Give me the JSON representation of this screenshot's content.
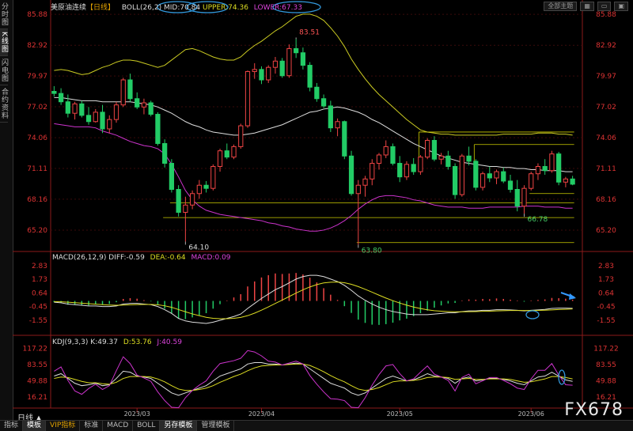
{
  "sidebar": {
    "items": [
      "分时图",
      "K线图",
      "闪电图",
      "合约资料"
    ]
  },
  "toolbar": {
    "theme_btn": "全部主题",
    "icons": [
      "grid-icon",
      "window-icon",
      "panel-icon"
    ]
  },
  "main_header": {
    "symbol": "美原油连续",
    "period": "【日线】",
    "boll_label": "BOLL(26,2)",
    "mid": "MID:70.84",
    "upper": "UPPER:74.36",
    "lower": "LOWER:67.33"
  },
  "macd_header": {
    "label": "MACD(26,12,9)",
    "diff": "DIFF:-0.59",
    "dea": "DEA:-0.64",
    "macd": "MACD:0.09"
  },
  "kdj_header": {
    "label": "KDJ(9,3,3)",
    "k": "K:49.37",
    "d": "D:53.76",
    "j": "J:40.59"
  },
  "price_ticks": [
    "85.88",
    "82.92",
    "79.97",
    "77.02",
    "74.06",
    "71.11",
    "68.16",
    "65.20"
  ],
  "macd_ticks": [
    "2.83",
    "1.73",
    "0.64",
    "-0.45",
    "-1.55"
  ],
  "kdj_ticks": [
    "117.22",
    "83.55",
    "49.88",
    "16.21"
  ],
  "date_labels": [
    "2023/03",
    "2023/04",
    "2023/05",
    "2023/06"
  ],
  "price_annotations": [
    "83.51",
    "64.10",
    "63.80",
    "66.78"
  ],
  "period_label": "日线 ▲",
  "bottom_tabs": [
    "指标",
    "模板",
    "VIP指标",
    "标准",
    "MACD",
    "BOLL",
    "另存模板",
    "管理模板"
  ],
  "watermark": "FX678",
  "colors": {
    "up": "#ee4444",
    "down": "#22cc66",
    "upper": "#cccc22",
    "mid": "#dddddd",
    "lower": "#cc33cc",
    "hline": "#cccc00",
    "circle": "#3399dd"
  },
  "chart_data": {
    "type": "candlestick",
    "title": "美原油连续 日线",
    "ylim": [
      63.3,
      86.5
    ],
    "candles_ohlc": [
      [
        78.5,
        79.0,
        78.0,
        78.3
      ],
      [
        78.3,
        78.8,
        77.2,
        77.5
      ],
      [
        77.5,
        78.2,
        76.0,
        76.4
      ],
      [
        76.4,
        77.5,
        75.8,
        77.3
      ],
      [
        77.3,
        77.6,
        76.0,
        76.2
      ],
      [
        76.2,
        77.0,
        75.3,
        75.6
      ],
      [
        75.6,
        76.8,
        75.5,
        76.5
      ],
      [
        76.5,
        77.2,
        74.5,
        74.9
      ],
      [
        74.9,
        76.2,
        74.5,
        75.8
      ],
      [
        75.8,
        77.5,
        75.5,
        77.2
      ],
      [
        77.2,
        79.8,
        77.0,
        79.6
      ],
      [
        79.6,
        80.2,
        77.5,
        77.8
      ],
      [
        77.8,
        78.4,
        76.8,
        77.0
      ],
      [
        77.0,
        77.8,
        76.3,
        77.4
      ],
      [
        77.4,
        77.6,
        76.1,
        76.3
      ],
      [
        76.3,
        76.5,
        73.3,
        73.5
      ],
      [
        73.5,
        73.9,
        71.2,
        71.6
      ],
      [
        71.6,
        72.0,
        68.8,
        69.1
      ],
      [
        69.1,
        69.5,
        66.5,
        66.9
      ],
      [
        66.9,
        68.4,
        64.1,
        67.6
      ],
      [
        67.6,
        69.0,
        67.2,
        68.7
      ],
      [
        68.7,
        70.0,
        68.2,
        69.5
      ],
      [
        69.5,
        69.9,
        68.8,
        69.2
      ],
      [
        69.2,
        71.5,
        69.0,
        71.3
      ],
      [
        71.3,
        73.0,
        70.8,
        72.8
      ],
      [
        72.8,
        73.5,
        72.0,
        72.2
      ],
      [
        72.2,
        73.4,
        72.0,
        73.2
      ],
      [
        73.2,
        75.4,
        73.0,
        75.2
      ],
      [
        75.2,
        80.5,
        75.0,
        80.4
      ],
      [
        80.4,
        81.2,
        79.7,
        80.6
      ],
      [
        80.6,
        80.9,
        79.2,
        79.6
      ],
      [
        79.6,
        81.0,
        79.3,
        80.8
      ],
      [
        80.8,
        81.8,
        80.2,
        81.4
      ],
      [
        81.4,
        81.7,
        79.8,
        80.0
      ],
      [
        80.0,
        83.0,
        79.8,
        82.6
      ],
      [
        82.6,
        83.51,
        81.7,
        82.2
      ],
      [
        82.2,
        82.7,
        80.6,
        81.0
      ],
      [
        81.0,
        81.3,
        78.5,
        78.9
      ],
      [
        78.9,
        79.3,
        77.5,
        77.8
      ],
      [
        77.8,
        78.2,
        76.9,
        77.1
      ],
      [
        77.1,
        77.6,
        74.6,
        75.0
      ],
      [
        75.0,
        75.9,
        74.2,
        75.6
      ],
      [
        75.6,
        75.7,
        72.0,
        72.3
      ],
      [
        72.3,
        72.8,
        68.5,
        68.7
      ],
      [
        68.7,
        70.0,
        63.8,
        69.5
      ],
      [
        69.5,
        70.4,
        68.4,
        70.1
      ],
      [
        70.1,
        72.0,
        69.5,
        71.6
      ],
      [
        71.6,
        72.6,
        71.0,
        72.4
      ],
      [
        72.4,
        73.8,
        72.1,
        73.2
      ],
      [
        73.2,
        73.5,
        71.4,
        71.6
      ],
      [
        71.6,
        72.3,
        69.8,
        70.3
      ],
      [
        70.3,
        71.8,
        70.0,
        71.5
      ],
      [
        71.5,
        72.1,
        70.5,
        70.8
      ],
      [
        70.8,
        72.4,
        70.5,
        72.2
      ],
      [
        72.2,
        74.0,
        72.0,
        73.8
      ],
      [
        73.8,
        74.2,
        71.8,
        72.0
      ],
      [
        72.0,
        72.6,
        71.5,
        72.3
      ],
      [
        72.3,
        72.8,
        71.0,
        71.3
      ],
      [
        71.3,
        71.6,
        68.2,
        68.6
      ],
      [
        68.6,
        72.5,
        68.4,
        72.3
      ],
      [
        72.3,
        73.2,
        71.4,
        71.8
      ],
      [
        71.8,
        72.0,
        69.0,
        69.3
      ],
      [
        69.3,
        70.8,
        69.0,
        70.6
      ],
      [
        70.6,
        71.3,
        69.8,
        70.2
      ],
      [
        70.2,
        71.0,
        69.6,
        70.8
      ],
      [
        70.8,
        71.2,
        69.7,
        69.9
      ],
      [
        69.9,
        70.5,
        68.8,
        69.1
      ],
      [
        69.1,
        70.0,
        67.0,
        67.5
      ],
      [
        67.5,
        69.5,
        66.78,
        69.2
      ],
      [
        69.2,
        70.8,
        69.0,
        70.6
      ],
      [
        70.6,
        71.6,
        70.0,
        71.3
      ],
      [
        71.3,
        72.0,
        70.5,
        70.9
      ],
      [
        70.9,
        72.8,
        70.7,
        72.5
      ],
      [
        72.5,
        72.7,
        69.5,
        69.8
      ],
      [
        69.8,
        70.3,
        69.3,
        70.1
      ],
      [
        70.1,
        70.4,
        69.5,
        69.6
      ]
    ],
    "boll_upper": [
      80.5,
      80.6,
      80.5,
      80.3,
      80.1,
      80.2,
      80.5,
      80.8,
      81.0,
      81.3,
      81.5,
      81.5,
      81.4,
      81.2,
      81.0,
      80.8,
      81.0,
      81.5,
      82.0,
      82.5,
      82.6,
      82.4,
      82.1,
      81.8,
      81.6,
      81.5,
      81.5,
      81.8,
      82.4,
      82.9,
      83.3,
      83.8,
      84.3,
      84.7,
      85.2,
      85.7,
      85.9,
      85.9,
      85.7,
      85.3,
      84.6,
      83.8,
      82.8,
      81.6,
      80.6,
      79.7,
      78.9,
      78.2,
      77.6,
      77.0,
      76.4,
      75.8,
      75.3,
      74.8,
      74.6,
      74.5,
      74.4,
      74.4,
      74.3,
      74.3,
      74.3,
      74.3,
      74.3,
      74.3,
      74.3,
      74.4,
      74.4,
      74.4,
      74.4,
      74.4,
      74.5,
      74.5,
      74.5,
      74.4,
      74.4,
      74.3
    ],
    "boll_mid": [
      77.9,
      77.9,
      77.8,
      77.7,
      77.6,
      77.6,
      77.6,
      77.5,
      77.5,
      77.5,
      77.5,
      77.5,
      77.4,
      77.3,
      77.2,
      77.0,
      76.7,
      76.4,
      76.0,
      75.6,
      75.3,
      75.1,
      74.8,
      74.6,
      74.5,
      74.4,
      74.3,
      74.3,
      74.4,
      74.5,
      74.7,
      74.9,
      75.1,
      75.3,
      75.6,
      75.9,
      76.2,
      76.5,
      76.6,
      76.8,
      76.9,
      77.0,
      76.9,
      76.7,
      76.5,
      76.2,
      75.8,
      75.5,
      75.1,
      74.7,
      74.3,
      73.9,
      73.5,
      73.2,
      72.9,
      72.6,
      72.3,
      72.1,
      71.9,
      71.7,
      71.6,
      71.5,
      71.4,
      71.3,
      71.3,
      71.2,
      71.2,
      71.1,
      71.1,
      71.0,
      71.0,
      70.9,
      70.9,
      70.9,
      70.8,
      70.8
    ],
    "boll_lower": [
      75.4,
      75.3,
      75.2,
      75.1,
      75.1,
      75.1,
      75.0,
      74.7,
      74.5,
      74.3,
      74.0,
      73.7,
      73.5,
      73.3,
      73.2,
      73.0,
      72.5,
      71.5,
      70.3,
      69.0,
      68.1,
      67.5,
      67.1,
      66.9,
      66.7,
      66.6,
      66.5,
      66.4,
      66.3,
      66.2,
      66.1,
      65.9,
      65.8,
      65.6,
      65.5,
      65.3,
      65.2,
      65.1,
      65.1,
      65.2,
      65.4,
      65.7,
      66.1,
      66.6,
      67.2,
      67.7,
      68.1,
      68.4,
      68.5,
      68.5,
      68.4,
      68.3,
      68.1,
      68.0,
      67.8,
      67.6,
      67.5,
      67.4,
      67.4,
      67.4,
      67.3,
      67.3,
      67.3,
      67.4,
      67.4,
      67.4,
      67.4,
      67.4,
      67.5,
      67.5,
      67.5,
      67.4,
      67.4,
      67.4,
      67.3,
      67.3
    ],
    "macd": {
      "ylim": [
        -2.5,
        3.2
      ],
      "diff": [
        -0.1,
        -0.15,
        -0.25,
        -0.3,
        -0.35,
        -0.4,
        -0.4,
        -0.45,
        -0.45,
        -0.4,
        -0.25,
        -0.2,
        -0.2,
        -0.25,
        -0.3,
        -0.45,
        -0.7,
        -1.0,
        -1.4,
        -1.6,
        -1.7,
        -1.75,
        -1.8,
        -1.7,
        -1.55,
        -1.4,
        -1.25,
        -1.05,
        -0.6,
        -0.2,
        0.2,
        0.55,
        0.9,
        1.15,
        1.45,
        1.75,
        1.95,
        2.05,
        2.05,
        1.95,
        1.75,
        1.55,
        1.25,
        0.85,
        0.4,
        0.05,
        -0.25,
        -0.5,
        -0.7,
        -0.85,
        -0.95,
        -1.05,
        -1.1,
        -1.1,
        -1.1,
        -1.05,
        -1.0,
        -0.95,
        -0.95,
        -0.85,
        -0.8,
        -0.8,
        -0.75,
        -0.75,
        -0.7,
        -0.7,
        -0.72,
        -0.75,
        -0.8,
        -0.75,
        -0.72,
        -0.68,
        -0.6,
        -0.58,
        -0.58,
        -0.59
      ],
      "dea": [
        -0.05,
        -0.07,
        -0.1,
        -0.14,
        -0.18,
        -0.22,
        -0.26,
        -0.3,
        -0.33,
        -0.35,
        -0.33,
        -0.31,
        -0.29,
        -0.28,
        -0.28,
        -0.31,
        -0.39,
        -0.51,
        -0.69,
        -0.87,
        -1.04,
        -1.18,
        -1.31,
        -1.39,
        -1.42,
        -1.42,
        -1.39,
        -1.32,
        -1.18,
        -0.98,
        -0.74,
        -0.48,
        -0.2,
        0.07,
        0.35,
        0.63,
        0.89,
        1.12,
        1.31,
        1.44,
        1.5,
        1.51,
        1.46,
        1.33,
        1.15,
        0.93,
        0.7,
        0.46,
        0.23,
        0.02,
        -0.17,
        -0.34,
        -0.49,
        -0.61,
        -0.71,
        -0.78,
        -0.82,
        -0.85,
        -0.87,
        -0.87,
        -0.86,
        -0.85,
        -0.83,
        -0.82,
        -0.8,
        -0.78,
        -0.77,
        -0.77,
        -0.77,
        -0.77,
        -0.76,
        -0.74,
        -0.72,
        -0.69,
        -0.67,
        -0.64
      ]
    },
    "kdj": {
      "ylim": [
        0,
        125
      ],
      "k": [
        60,
        65,
        55,
        45,
        40,
        42,
        45,
        40,
        42,
        55,
        70,
        68,
        60,
        58,
        55,
        45,
        35,
        25,
        20,
        25,
        30,
        35,
        40,
        50,
        60,
        65,
        70,
        75,
        85,
        88,
        88,
        85,
        85,
        83,
        85,
        87,
        85,
        75,
        65,
        55,
        45,
        40,
        35,
        25,
        20,
        25,
        35,
        45,
        55,
        60,
        55,
        50,
        52,
        58,
        65,
        60,
        58,
        55,
        45,
        55,
        58,
        50,
        52,
        55,
        55,
        53,
        50,
        45,
        42,
        50,
        58,
        60,
        68,
        60,
        52,
        49
      ],
      "d": [
        55,
        58,
        57,
        53,
        49,
        46,
        46,
        44,
        43,
        47,
        55,
        59,
        59,
        59,
        58,
        54,
        48,
        40,
        33,
        30,
        30,
        32,
        35,
        40,
        47,
        53,
        59,
        64,
        71,
        77,
        81,
        82,
        83,
        83,
        84,
        85,
        85,
        82,
        76,
        69,
        61,
        54,
        48,
        40,
        33,
        30,
        32,
        36,
        42,
        48,
        50,
        50,
        51,
        53,
        57,
        58,
        58,
        57,
        53,
        54,
        55,
        53,
        53,
        54,
        54,
        54,
        53,
        50,
        47,
        48,
        51,
        54,
        59,
        59,
        57,
        54
      ],
      "j": [
        70,
        79,
        51,
        29,
        22,
        34,
        43,
        32,
        40,
        71,
        100,
        86,
        62,
        56,
        49,
        27,
        9,
        -5,
        -6,
        15,
        30,
        41,
        50,
        70,
        86,
        89,
        92,
        97,
        113,
        110,
        102,
        91,
        89,
        83,
        87,
        91,
        85,
        61,
        43,
        27,
        13,
        12,
        9,
        -5,
        -6,
        15,
        41,
        63,
        81,
        84,
        65,
        50,
        54,
        68,
        81,
        64,
        58,
        51,
        29,
        57,
        64,
        44,
        50,
        57,
        57,
        51,
        44,
        35,
        32,
        54,
        72,
        72,
        86,
        62,
        42,
        41
      ]
    }
  }
}
